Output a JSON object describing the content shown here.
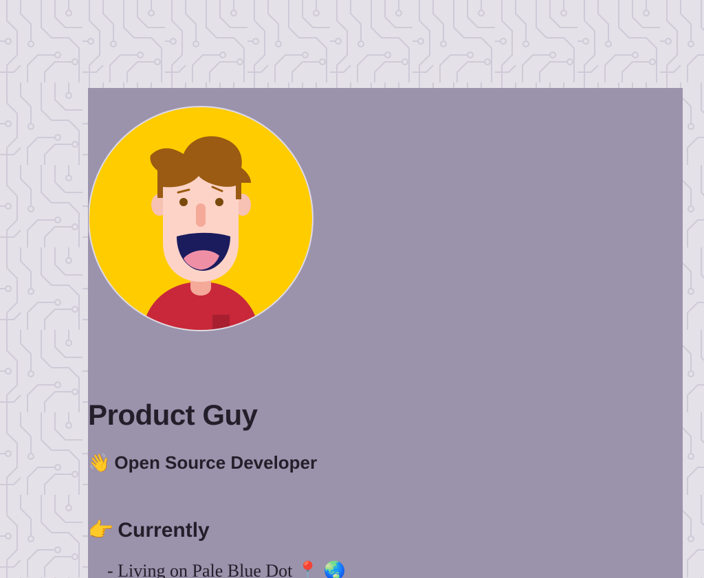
{
  "profile": {
    "name": "Product Guy",
    "tagline_emoji": "👋",
    "tagline": "Open Source Developer",
    "currently": {
      "emoji": "👉",
      "heading": "Currently",
      "items": [
        {
          "text": "- Living on Pale Blue Dot",
          "icons": [
            "📍",
            "🌏"
          ]
        }
      ]
    }
  },
  "colors": {
    "page_background": "#e4e1e8",
    "circuit_lines": "#cfcad7",
    "card_background": "#9b92ac",
    "avatar_background": "#ffcc00",
    "hair": "#9b5b12",
    "shirt": "#c8283a",
    "text": "#231f2a"
  },
  "icons": {
    "avatar": "cartoon-avatar-icon",
    "wave": "waving-hand-icon",
    "pointer": "pointing-right-icon",
    "pin": "map-pin-icon",
    "globe": "globe-icon"
  }
}
